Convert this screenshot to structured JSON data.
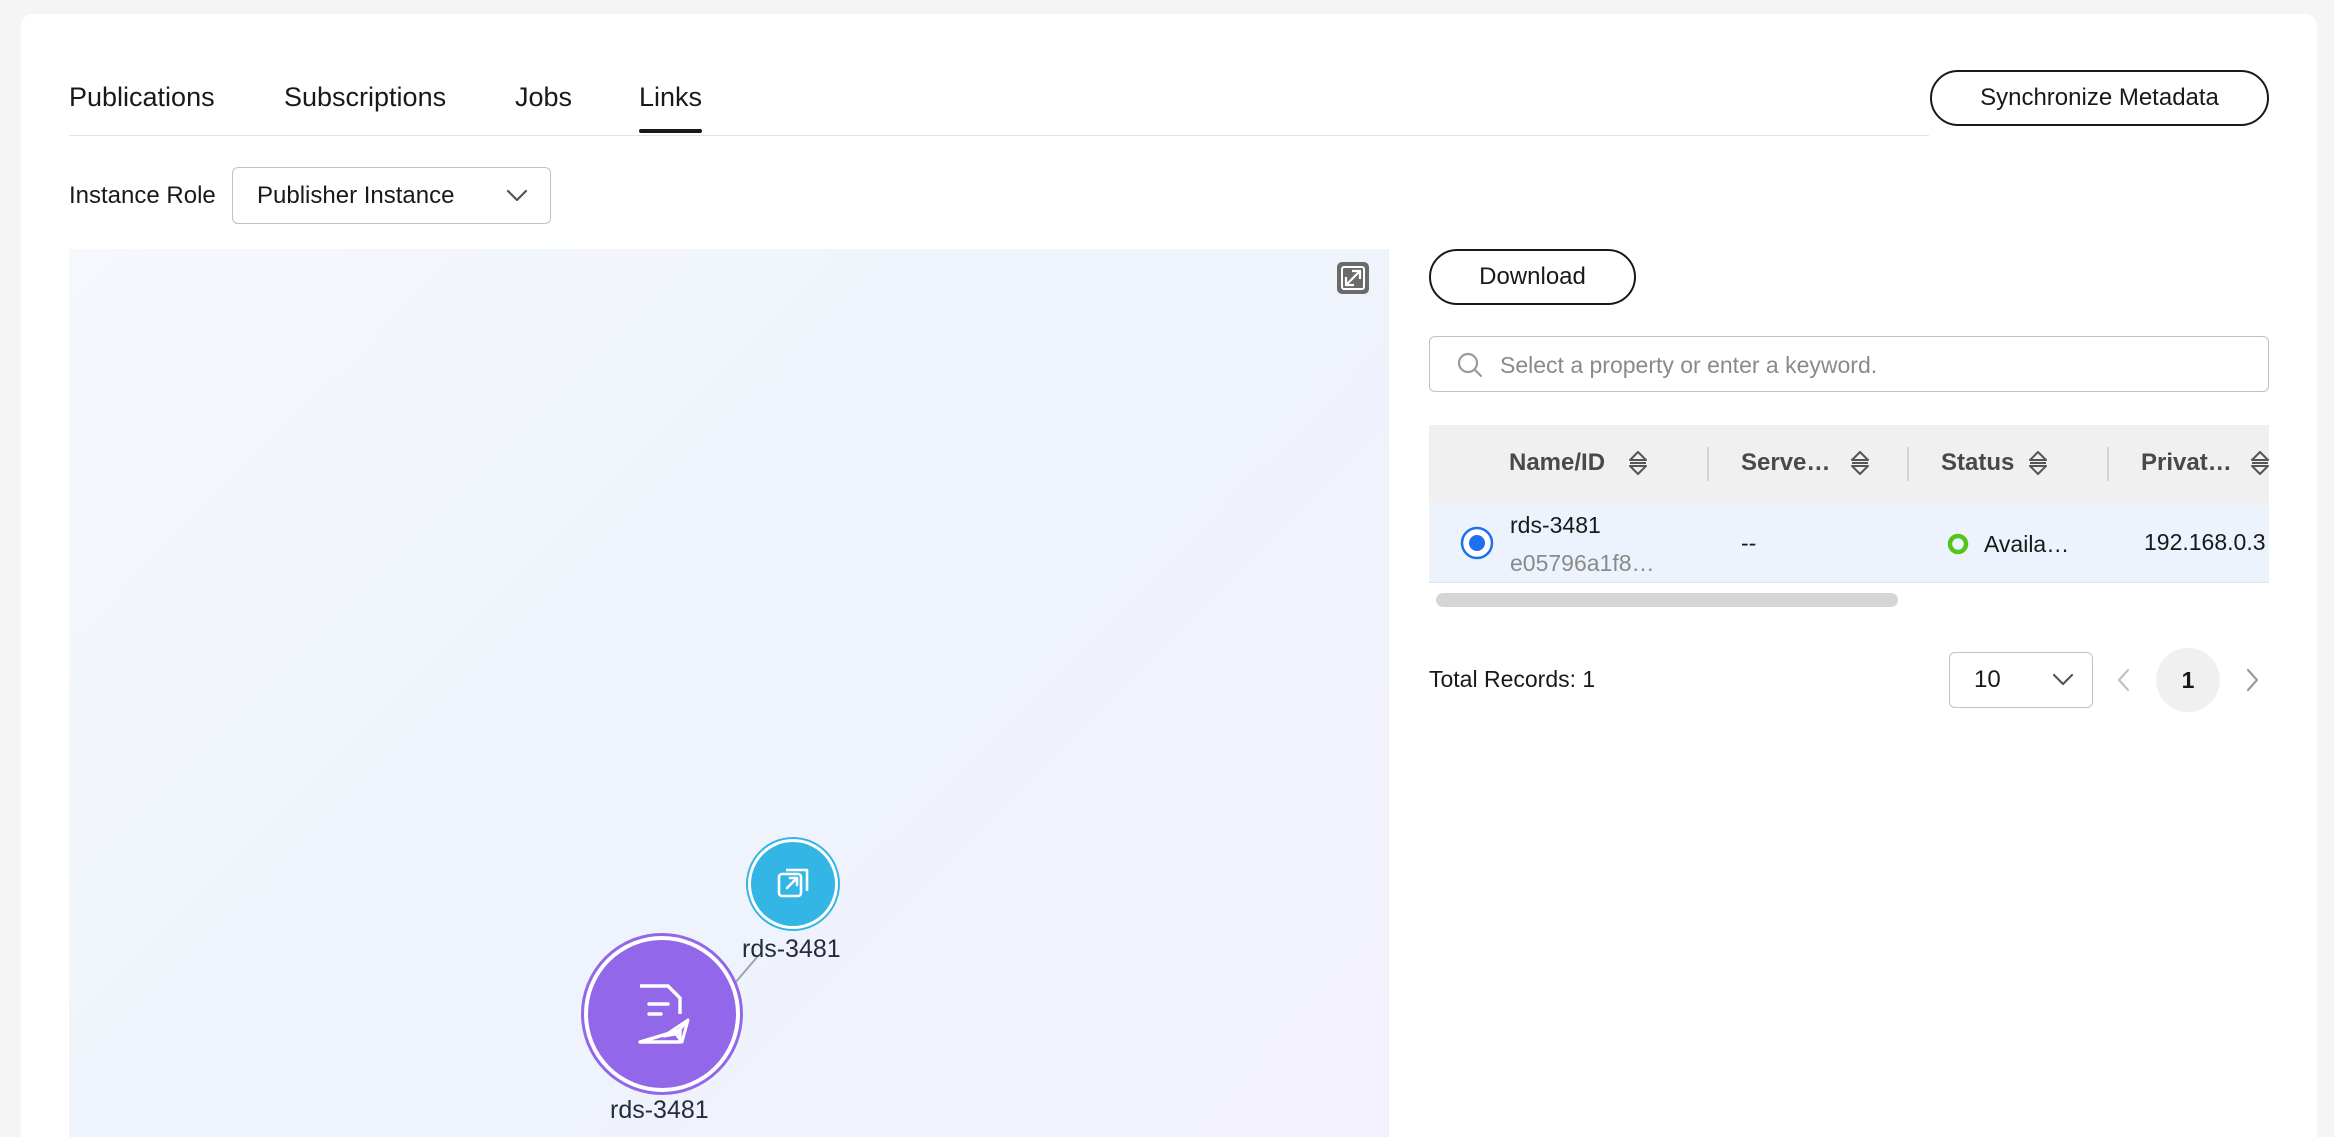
{
  "tabs": [
    {
      "label": "Publications",
      "active": false
    },
    {
      "label": "Subscriptions",
      "active": false
    },
    {
      "label": "Jobs",
      "active": false
    },
    {
      "label": "Links",
      "active": true
    }
  ],
  "sync_button": "Synchronize Metadata",
  "instance_role": {
    "label": "Instance Role",
    "value": "Publisher Instance"
  },
  "graph": {
    "nodes": [
      {
        "label": "rds-3481",
        "kind": "subscriber",
        "icon": "external-link-icon",
        "color": "#33b5e5"
      },
      {
        "label": "rds-3481",
        "kind": "publisher",
        "icon": "document-send-icon",
        "color": "#9267ea"
      }
    ],
    "fullscreen_icon": "expand-icon"
  },
  "download_button": "Download",
  "search": {
    "placeholder": "Select a property or enter a keyword."
  },
  "table": {
    "columns": [
      "Name/ID",
      "Serve…",
      "Status",
      "Privat…"
    ],
    "rows": [
      {
        "selected": true,
        "name": "rds-3481",
        "id": "e05796a1f8…",
        "server": "--",
        "status": "Availa…",
        "status_color": "#52c41a",
        "private_ip": "192.168.0.3"
      }
    ]
  },
  "pagination": {
    "total": "Total Records: 1",
    "page_size": "10",
    "current_page": "1"
  },
  "colors": {
    "accent": "#1f6ff0",
    "publisher_node": "#9267ea",
    "subscriber_node": "#33b5e5"
  }
}
